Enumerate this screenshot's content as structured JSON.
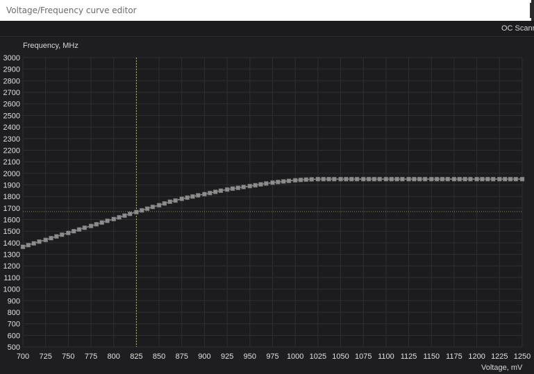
{
  "window": {
    "title": "Voltage/Frequency curve editor"
  },
  "toolbar": {
    "oc_scanner_label": "OC Scann"
  },
  "chart_data": {
    "type": "line",
    "xlabel": "Voltage, mV",
    "ylabel": "Frequency, MHz",
    "xlim": [
      700,
      1250
    ],
    "ylim": [
      500,
      3000
    ],
    "x_ticks": [
      700,
      725,
      750,
      775,
      800,
      825,
      850,
      875,
      900,
      925,
      950,
      975,
      1000,
      1025,
      1050,
      1075,
      1100,
      1125,
      1150,
      1175,
      1200,
      1225,
      1250
    ],
    "y_ticks": [
      500,
      600,
      700,
      800,
      900,
      1000,
      1100,
      1200,
      1300,
      1400,
      1500,
      1600,
      1700,
      1800,
      1900,
      2000,
      2100,
      2200,
      2300,
      2400,
      2500,
      2600,
      2700,
      2800,
      2900,
      3000
    ],
    "grid": true,
    "selected_point": {
      "x": 825,
      "y": 1670
    },
    "series": [
      {
        "x": [
          700,
          706,
          712,
          718,
          725,
          731,
          737,
          743,
          750,
          756,
          762,
          768,
          775,
          781,
          787,
          793,
          800,
          806,
          812,
          818,
          825,
          831,
          837,
          843,
          850,
          856,
          862,
          868,
          875,
          881,
          887,
          893,
          900,
          906,
          912,
          918,
          925,
          931,
          937,
          943,
          950,
          956,
          962,
          968,
          975,
          981,
          987,
          993,
          1000,
          1006,
          1012,
          1018,
          1025,
          1031,
          1037,
          1043,
          1050,
          1056,
          1062,
          1068,
          1075,
          1081,
          1087,
          1093,
          1100,
          1106,
          1112,
          1118,
          1125,
          1131,
          1137,
          1143,
          1150,
          1156,
          1162,
          1168,
          1175,
          1181,
          1187,
          1193,
          1200,
          1206,
          1212,
          1218,
          1225,
          1231,
          1237,
          1243,
          1250
        ],
        "y": [
          1365,
          1380,
          1395,
          1410,
          1425,
          1440,
          1455,
          1470,
          1485,
          1500,
          1515,
          1530,
          1545,
          1560,
          1575,
          1590,
          1605,
          1620,
          1635,
          1650,
          1665,
          1680,
          1695,
          1710,
          1725,
          1740,
          1755,
          1765,
          1780,
          1790,
          1800,
          1810,
          1820,
          1830,
          1840,
          1850,
          1860,
          1868,
          1875,
          1882,
          1890,
          1897,
          1905,
          1912,
          1920,
          1925,
          1930,
          1935,
          1940,
          1943,
          1946,
          1948,
          1950,
          1950,
          1950,
          1950,
          1950,
          1950,
          1950,
          1950,
          1950,
          1950,
          1950,
          1950,
          1950,
          1950,
          1950,
          1950,
          1950,
          1950,
          1950,
          1950,
          1950,
          1950,
          1950,
          1950,
          1950,
          1950,
          1950,
          1950,
          1950,
          1950,
          1950,
          1950,
          1950,
          1950,
          1950,
          1950,
          1950
        ]
      }
    ]
  }
}
